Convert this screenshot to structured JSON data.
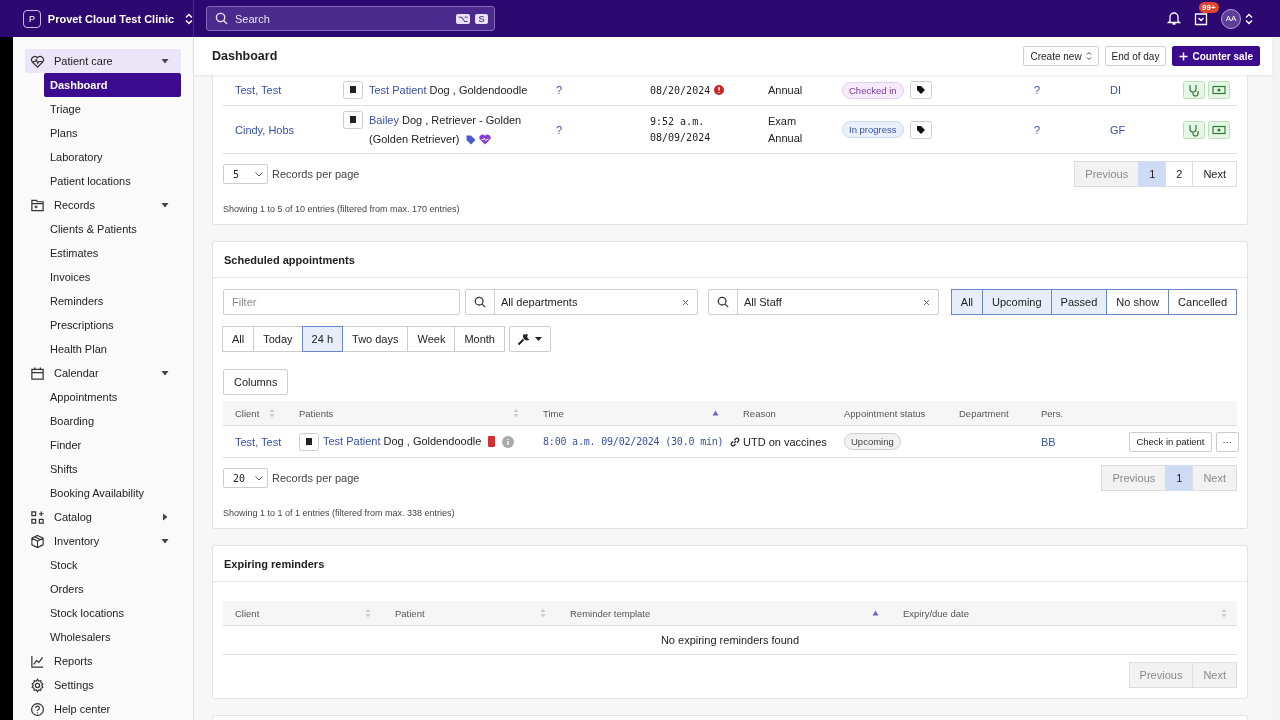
{
  "topbar": {
    "clinic_initial": "P",
    "clinic_name": "Provet Cloud Test Clinic",
    "search_placeholder": "Search",
    "shortcut_keys": [
      "⌥",
      "S"
    ],
    "inbox_badge": "99+",
    "avatar": "AA"
  },
  "sidebar": [
    {
      "label": "Patient care",
      "expanded": true,
      "selected": true,
      "children": [
        {
          "label": "Dashboard",
          "selected": true
        },
        {
          "label": "Triage",
          "selected": false
        },
        {
          "label": "Plans",
          "selected": false
        },
        {
          "label": "Laboratory",
          "selected": false
        },
        {
          "label": "Patient locations",
          "selected": false
        }
      ]
    },
    {
      "label": "Records",
      "expanded": true,
      "selected": false,
      "children": [
        {
          "label": "Clients & Patients",
          "selected": false
        },
        {
          "label": "Estimates",
          "selected": false
        },
        {
          "label": "Invoices",
          "selected": false
        },
        {
          "label": "Reminders",
          "selected": false
        },
        {
          "label": "Prescriptions",
          "selected": false
        },
        {
          "label": "Health Plan",
          "selected": false
        }
      ]
    },
    {
      "label": "Calendar",
      "expanded": true,
      "selected": false,
      "children": [
        {
          "label": "Appointments",
          "selected": false
        },
        {
          "label": "Boarding",
          "selected": false
        },
        {
          "label": "Finder",
          "selected": false
        },
        {
          "label": "Shifts",
          "selected": false
        },
        {
          "label": "Booking Availability",
          "selected": false
        }
      ]
    },
    {
      "label": "Catalog",
      "expanded": false,
      "selected": false
    },
    {
      "label": "Inventory",
      "expanded": true,
      "selected": false,
      "children": [
        {
          "label": "Stock",
          "selected": false
        },
        {
          "label": "Orders",
          "selected": false
        },
        {
          "label": "Stock locations",
          "selected": false
        },
        {
          "label": "Wholesalers",
          "selected": false
        }
      ]
    },
    {
      "label": "Reports",
      "selected": false
    },
    {
      "label": "Settings",
      "selected": false
    },
    {
      "label": "Help center",
      "selected": false
    }
  ],
  "header": {
    "title": "Dashboard",
    "buttons": [
      {
        "label": "Create new",
        "kind": "menu"
      },
      {
        "label": "End of day",
        "kind": "plain"
      },
      {
        "label": "Counter sale",
        "kind": "primary"
      }
    ]
  },
  "todays_table": {
    "rows": [
      {
        "client": "Test, Test",
        "patient": "Test Patient",
        "species": "Dog , Goldendoodle",
        "column_3": "?",
        "time": [
          "08/20/2024"
        ],
        "alert": true,
        "reason": [
          "Annual"
        ],
        "status": {
          "label": "Checked in",
          "kind": "checked_in"
        },
        "column_7": "?",
        "staff": "DI"
      },
      {
        "client": "Cindy, Hobs",
        "patient": "Bailey",
        "species": "Dog , Retriever - Golden (Golden Retriever)",
        "column_3": "?",
        "time": [
          "9:52 a.m.",
          "08/09/2024"
        ],
        "alert": false,
        "reason": [
          "Exam",
          "Annual"
        ],
        "status": {
          "label": "In progress",
          "kind": "in_progress"
        },
        "column_7": "?",
        "staff": "GF"
      }
    ],
    "per_page": "5",
    "per_page_label": "Records per page",
    "pages": [
      {
        "label": "Previous",
        "disabled": true,
        "selected": false
      },
      {
        "label": "1",
        "disabled": false,
        "selected": true
      },
      {
        "label": "2",
        "disabled": false,
        "selected": false
      },
      {
        "label": "Next",
        "disabled": false,
        "selected": false
      }
    ],
    "summary": "Showing 1 to 5 of 10 entries (filtered from max. 170 entries)"
  },
  "scheduled": {
    "title": "Scheduled appointments",
    "filter_placeholder": "Filter",
    "department": "All departments",
    "staff": "All Staff",
    "status_filters": [
      {
        "label": "All",
        "selected": true
      },
      {
        "label": "Upcoming",
        "selected": true
      },
      {
        "label": "Passed",
        "selected": true
      },
      {
        "label": "No show",
        "selected": false
      },
      {
        "label": "Cancelled",
        "selected": false
      }
    ],
    "ranges": [
      {
        "label": "All",
        "selected": false
      },
      {
        "label": "Today",
        "selected": false
      },
      {
        "label": "24 h",
        "selected": true
      },
      {
        "label": "Two days",
        "selected": false
      },
      {
        "label": "Week",
        "selected": false
      },
      {
        "label": "Month",
        "selected": false
      }
    ],
    "columns_button": "Columns",
    "columns": [
      {
        "label": "Client"
      },
      {
        "label": "Patients"
      },
      {
        "label": "Time"
      },
      {
        "label": "Reason"
      },
      {
        "label": "Appointment status"
      },
      {
        "label": "Department"
      },
      {
        "label": "Pers."
      }
    ],
    "rows": [
      {
        "client": "Test, Test",
        "patient": "Test Patient",
        "species": "Dog , Goldendoodle",
        "time": "8:00 a.m. 09/02/2024 (30.0 min)",
        "reason": "UTD on vaccines",
        "status": {
          "label": "Upcoming",
          "kind": "upcoming"
        },
        "staff": "BB",
        "action": "Check in patient",
        "more": "···"
      }
    ],
    "per_page": "20",
    "per_page_label": "Records per page",
    "pages": [
      {
        "label": "Previous",
        "disabled": true,
        "selected": false
      },
      {
        "label": "1",
        "disabled": false,
        "selected": true
      },
      {
        "label": "Next",
        "disabled": true,
        "selected": false
      }
    ],
    "summary": "Showing 1 to 1 of 1 entries (filtered from max. 338 entries)"
  },
  "reminders": {
    "title": "Expiring reminders",
    "columns": [
      {
        "label": "Client"
      },
      {
        "label": "Patient"
      },
      {
        "label": "Reminder template"
      },
      {
        "label": "Expiry/due date"
      }
    ],
    "empty": "No expiring reminders found",
    "pages": [
      {
        "label": "Previous",
        "disabled": true,
        "selected": false
      },
      {
        "label": "Next",
        "disabled": true,
        "selected": false
      }
    ]
  }
}
